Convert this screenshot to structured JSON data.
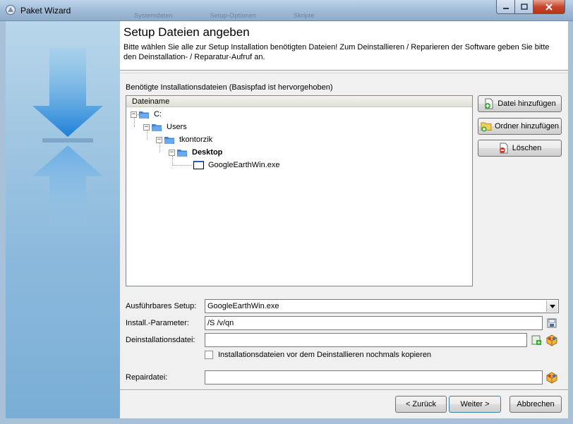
{
  "window": {
    "title": "Paket Wizard",
    "ghost_tabs": [
      "Systemdaten",
      "Setup-Optionen",
      "Skripte"
    ]
  },
  "header": {
    "title": "Setup Dateien angeben",
    "description": "Bitte wählen Sie alle zur Setup Installation benötigten Dateien! Zum Deinstallieren / Reparieren der Software geben Sie bitte den Deinstallation- / Reparatur-Aufruf an."
  },
  "files": {
    "group_label": "Benötigte Installationsdateien (Basispfad ist hervorgehoben)",
    "column_header": "Dateiname",
    "tree": [
      {
        "label": "C:",
        "level": 0,
        "type": "folder",
        "bold": false
      },
      {
        "label": "Users",
        "level": 1,
        "type": "folder",
        "bold": false
      },
      {
        "label": "tkontorzik",
        "level": 2,
        "type": "folder",
        "bold": false
      },
      {
        "label": "Desktop",
        "level": 3,
        "type": "folder",
        "bold": true
      },
      {
        "label": "GoogleEarthWin.exe",
        "level": 4,
        "type": "file",
        "bold": false
      }
    ]
  },
  "actions": {
    "add_file": "Datei hinzufügen",
    "add_folder": "Ordner hinzufügen",
    "delete": "Löschen"
  },
  "form": {
    "setup_label": "Ausführbares Setup:",
    "setup_value": "GoogleEarthWin.exe",
    "params_label": "Install.-Parameter:",
    "params_value": "/S /v/qn",
    "uninstall_label": "Deinstallationsdatei:",
    "uninstall_value": "",
    "copy_checkbox_label": "Installationsdateien vor dem Deinstallieren nochmals kopieren",
    "copy_checkbox_checked": false,
    "repair_label": "Repairdatei:",
    "repair_value": ""
  },
  "footer": {
    "back": "< Zurück",
    "next": "Weiter >",
    "cancel": "Abbrechen"
  },
  "colors": {
    "accent": "#4a9ad8",
    "folder": "#3c82d6",
    "close": "#c7472d"
  }
}
